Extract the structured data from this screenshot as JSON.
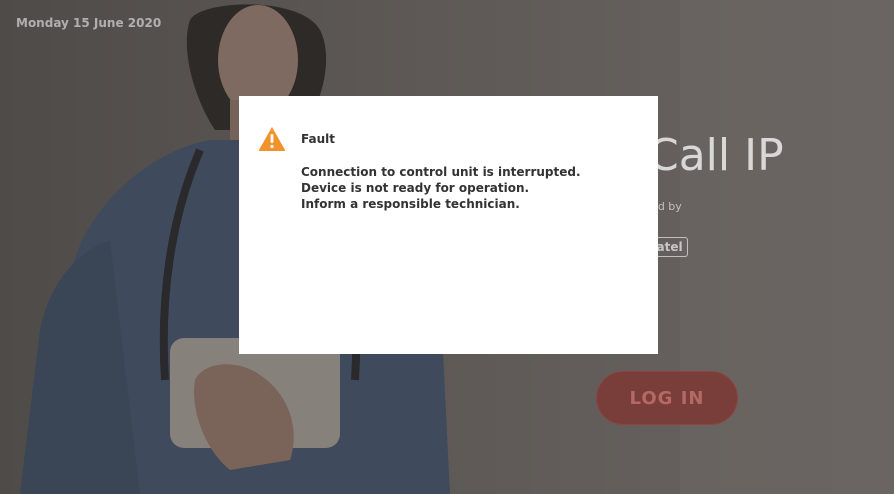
{
  "background": {
    "date": "Monday 15 June 2020",
    "brand_title": "Call IP",
    "powered_by": "ered by",
    "brand_logo_text": "natel",
    "login_label": "LOG IN"
  },
  "dialog": {
    "title": "Fault",
    "icon": "warning-icon",
    "lines": [
      "Connection to control unit is interrupted.",
      "Device is not ready for operation.",
      "Inform a responsible technician."
    ]
  },
  "colors": {
    "overlay": "#5a5653",
    "warning": "#f0932b",
    "login_button": "#7a3e3a",
    "dialog_bg": "#ffffff",
    "text": "#333333"
  }
}
